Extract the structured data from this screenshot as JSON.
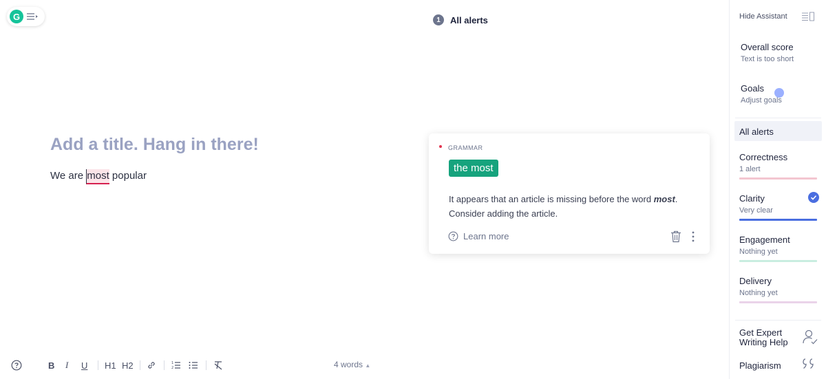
{
  "header": {
    "alert_count": "1",
    "alerts_label": "All alerts"
  },
  "editor": {
    "title_placeholder": "Add a title. Hang in there!",
    "body_before": "We are ",
    "body_highlight": "most",
    "body_after": " popular"
  },
  "card": {
    "category": "GRAMMAR",
    "suggestion": "the most",
    "message_before": "It appears that an article is missing before the word ",
    "message_emphasis": "most",
    "message_after": ". Consider adding the article.",
    "learn_more": "Learn more"
  },
  "toolbar": {
    "bold": "B",
    "italic": "I",
    "underline": "U",
    "h1": "H1",
    "h2": "H2",
    "word_count": "4 words"
  },
  "sidebar": {
    "hide_assistant": "Hide Assistant",
    "overall_score": {
      "title": "Overall score",
      "subtitle": "Text is too short"
    },
    "goals": {
      "title": "Goals",
      "subtitle": "Adjust goals"
    },
    "all_alerts": "All alerts",
    "categories": [
      {
        "name": "Correctness",
        "status": "1 alert",
        "color": "#f3c6d0"
      },
      {
        "name": "Clarity",
        "status": "Very clear",
        "color": "#4a6ee0"
      },
      {
        "name": "Engagement",
        "status": "Nothing yet",
        "color": "#c9ede0"
      },
      {
        "name": "Delivery",
        "status": "Nothing yet",
        "color": "#ead3e9"
      }
    ],
    "expert_help": "Get Expert Writing Help",
    "plagiarism": "Plagiarism"
  },
  "colors": {
    "brand_green": "#15c39a",
    "suggestion_green": "#16a37d",
    "error_red": "#d6204f",
    "title_placeholder": "#9aa2c2"
  },
  "icons": [
    "grammarly-logo-icon",
    "menu-icon",
    "help-icon",
    "link-icon",
    "ordered-list-icon",
    "unordered-list-icon",
    "clear-format-icon",
    "trash-icon",
    "more-icon",
    "question-icon",
    "panel-icon",
    "check-icon",
    "expert-icon",
    "quote-icon"
  ]
}
